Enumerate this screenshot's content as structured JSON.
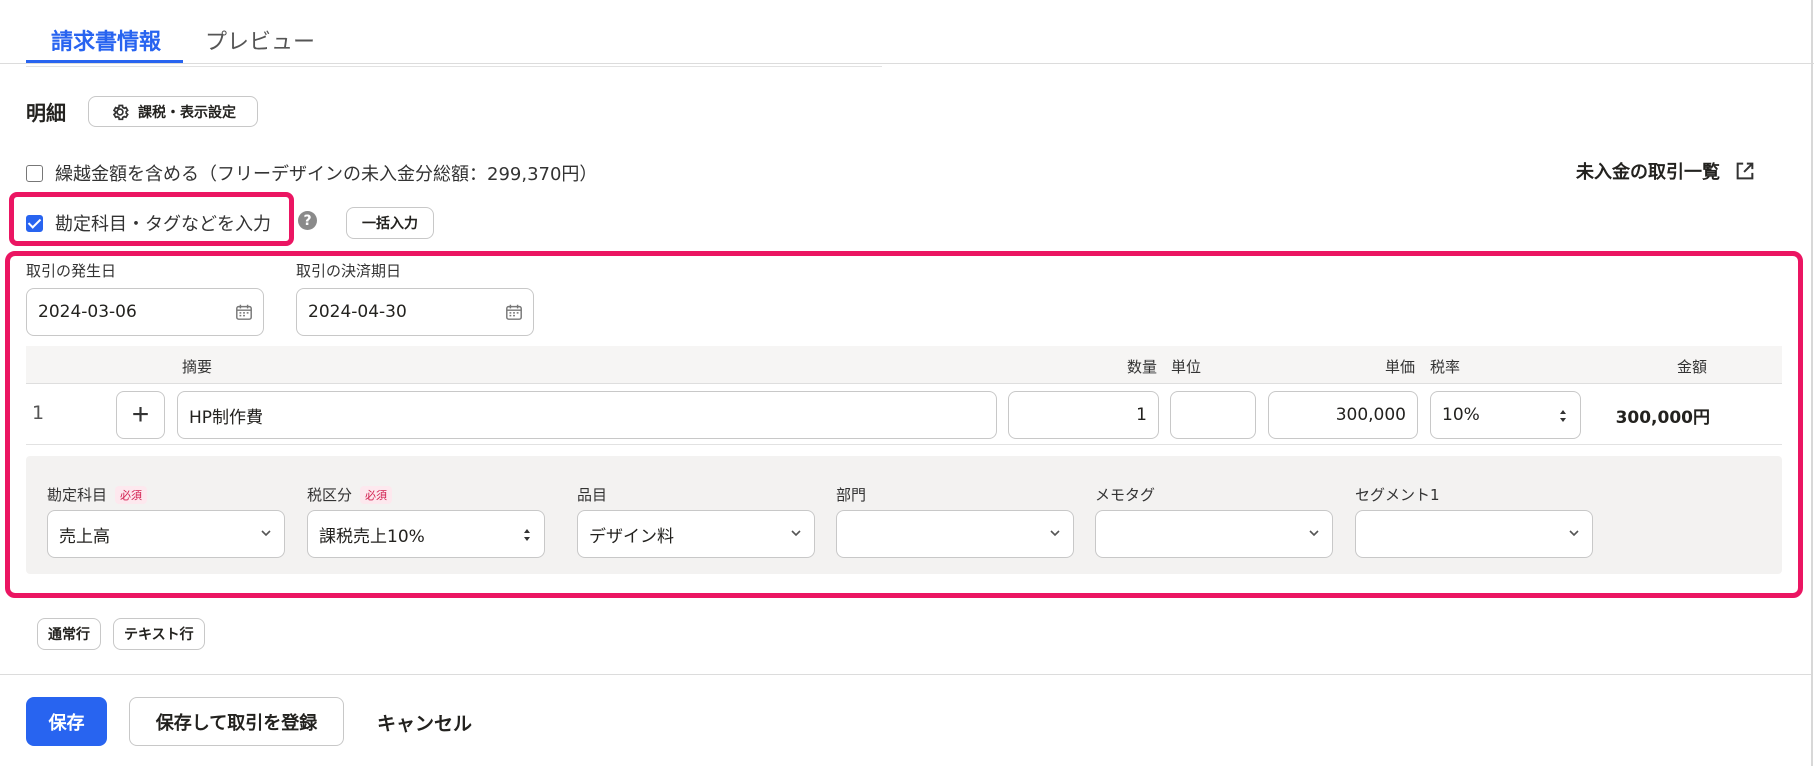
{
  "tabs": {
    "active": "請求書情報",
    "inactive": "プレビュー"
  },
  "details": {
    "title": "明細",
    "settings_label": "課税・表示設定"
  },
  "carryover": {
    "label": "繰越金額を含める（フリーデザインの未入金分総額：299,370円）",
    "checked": false
  },
  "tags_option": {
    "label": "勘定科目・タグなどを入力",
    "checked": true,
    "help": "?"
  },
  "bulk_input_label": "一括入力",
  "ar_link_label": "未入金の取引一覧",
  "dates": {
    "issue_label": "取引の発生日",
    "issue_value": "2024-03-06",
    "due_label": "取引の決済期日",
    "due_value": "2024-04-30"
  },
  "table": {
    "headers": {
      "description": "摘要",
      "qty": "数量",
      "unit": "単位",
      "unit_price": "単価",
      "tax_rate": "税率",
      "amount": "金額"
    },
    "row": {
      "num": "1",
      "add": "+",
      "description": "HP制作費",
      "qty": "1",
      "unit": "",
      "unit_price": "300,000",
      "tax_rate": "10%",
      "amount": "300,000円"
    }
  },
  "sub_fields": {
    "account": {
      "label": "勘定科目",
      "required": "必須",
      "value": "売上高"
    },
    "tax_class": {
      "label": "税区分",
      "required": "必須",
      "value": "課税売上10%"
    },
    "item": {
      "label": "品目",
      "value": "デザイン料"
    },
    "department": {
      "label": "部門",
      "value": ""
    },
    "memo_tag": {
      "label": "メモタグ",
      "value": ""
    },
    "segment1": {
      "label": "セグメント1",
      "value": ""
    }
  },
  "add_rows": {
    "normal": "通常行",
    "text": "テキスト行"
  },
  "footer": {
    "save": "保存",
    "save_register": "保存して取引を登録",
    "cancel": "キャンセル"
  },
  "colors": {
    "accent": "#2864f0",
    "highlight": "#eb1562"
  }
}
